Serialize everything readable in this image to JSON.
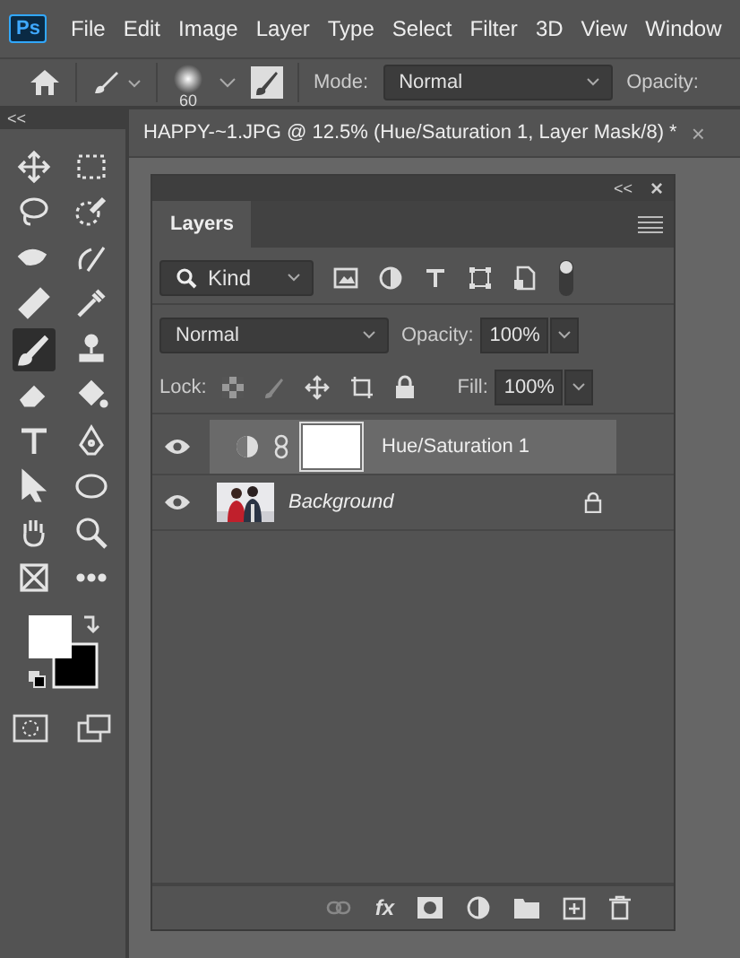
{
  "app_logo": "Ps",
  "menu": [
    "File",
    "Edit",
    "Image",
    "Layer",
    "Type",
    "Select",
    "Filter",
    "3D",
    "View",
    "Window"
  ],
  "options_bar": {
    "brush_size": "60",
    "mode_label": "Mode:",
    "mode_value": "Normal",
    "opacity_label": "Opacity:"
  },
  "tools_panel": {
    "collapse": "<<",
    "tools": [
      {
        "kind": "move",
        "selected": false
      },
      {
        "kind": "marquee",
        "selected": false
      },
      {
        "kind": "lasso",
        "selected": false
      },
      {
        "kind": "quick-select",
        "selected": false
      },
      {
        "kind": "heal",
        "selected": false
      },
      {
        "kind": "brush-heal",
        "selected": false
      },
      {
        "kind": "bandage",
        "selected": false
      },
      {
        "kind": "eyedropper",
        "selected": false
      },
      {
        "kind": "brush",
        "selected": true
      },
      {
        "kind": "stamp",
        "selected": false
      },
      {
        "kind": "eraser",
        "selected": false
      },
      {
        "kind": "bucket",
        "selected": false
      },
      {
        "kind": "type",
        "selected": false
      },
      {
        "kind": "pen",
        "selected": false
      },
      {
        "kind": "pointer",
        "selected": false
      },
      {
        "kind": "ellipse",
        "selected": false
      },
      {
        "kind": "hand",
        "selected": false
      },
      {
        "kind": "zoom",
        "selected": false
      },
      {
        "kind": "frame",
        "selected": false
      },
      {
        "kind": "more",
        "selected": false
      }
    ]
  },
  "document_tab": {
    "title": "HAPPY-~1.JPG @ 12.5% (Hue/Saturation 1, Layer Mask/8) *",
    "close": "×"
  },
  "layers_panel": {
    "collapse": "<<",
    "close": "×",
    "tab": "Layers",
    "filter_kind": "Kind",
    "blend_mode": "Normal",
    "opacity_label": "Opacity:",
    "opacity_value": "100%",
    "lock_label": "Lock:",
    "fill_label": "Fill:",
    "fill_value": "100%",
    "layers": [
      {
        "kind": "adjustment",
        "name": "Hue/Saturation 1",
        "visible": true,
        "selected": true,
        "locked": false
      },
      {
        "name": "Background",
        "visible": true,
        "selected": false,
        "locked": true
      }
    ],
    "footer_fx": "fx"
  }
}
